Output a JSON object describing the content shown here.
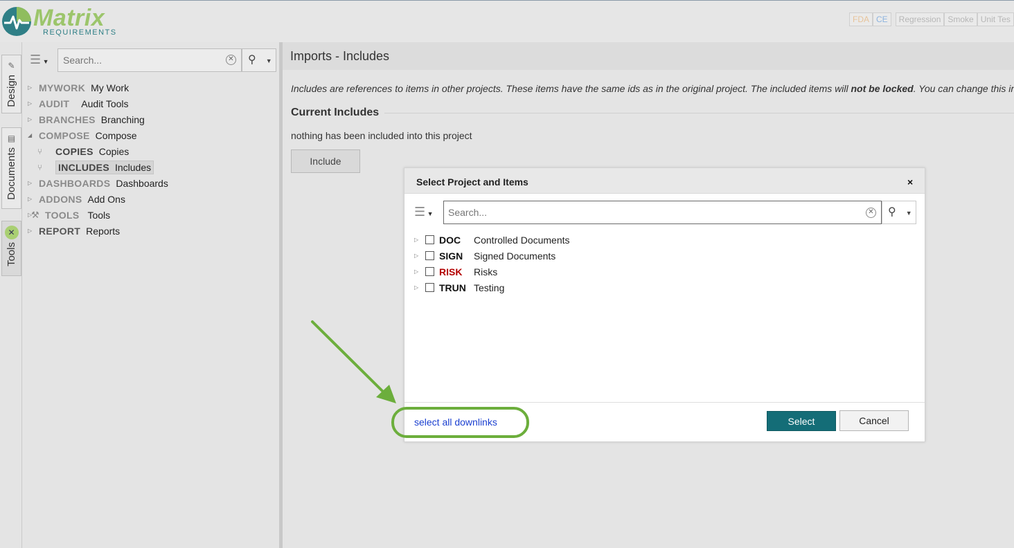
{
  "logo": {
    "word": "Matrix",
    "sub": "REQUIREMENTS"
  },
  "tags": [
    "FDA",
    "CE",
    "Regression",
    "Smoke",
    "Unit Tes"
  ],
  "vtabs": {
    "design": "Design",
    "documents": "Documents",
    "tools": "Tools"
  },
  "tree": {
    "search_placeholder": "Search...",
    "items": [
      {
        "code": "MYWORK",
        "name": "My Work"
      },
      {
        "code": "AUDIT",
        "name": "Audit Tools"
      },
      {
        "code": "BRANCHES",
        "name": "Branching"
      },
      {
        "code": "COMPOSE",
        "name": "Compose"
      },
      {
        "code": "COPIES",
        "name": "Copies"
      },
      {
        "code": "INCLUDES",
        "name": "Includes"
      },
      {
        "code": "DASHBOARDS",
        "name": "Dashboards"
      },
      {
        "code": "ADDONS",
        "name": "Add Ons"
      },
      {
        "code": "TOOLS",
        "name": "Tools"
      },
      {
        "code": "REPORT",
        "name": "Reports"
      }
    ]
  },
  "main": {
    "title": "Imports - Includes",
    "intro_start": "Includes are references to items in other projects. These items have the same ids as in the original project. The included items will ",
    "intro_bold": "not be locked",
    "intro_end": ". You can change this in the include",
    "section_title": "Current Includes",
    "nothing_text": "nothing has been included into this project",
    "include_button": "Include"
  },
  "dialog": {
    "title": "Select Project and Items",
    "close": "×",
    "search_placeholder": "Search...",
    "items": [
      {
        "code": "DOC",
        "name": "Controlled Documents"
      },
      {
        "code": "SIGN",
        "name": "Signed Documents"
      },
      {
        "code": "RISK",
        "name": "Risks"
      },
      {
        "code": "TRUN",
        "name": "Testing"
      }
    ],
    "downlinks_link": "select all downlinks",
    "select_button": "Select",
    "cancel_button": "Cancel"
  },
  "colors": {
    "accent_teal": "#146d77",
    "risk_red": "#b30000",
    "link_blue": "#1a3fd0",
    "annotation_green": "#6cae3c"
  }
}
